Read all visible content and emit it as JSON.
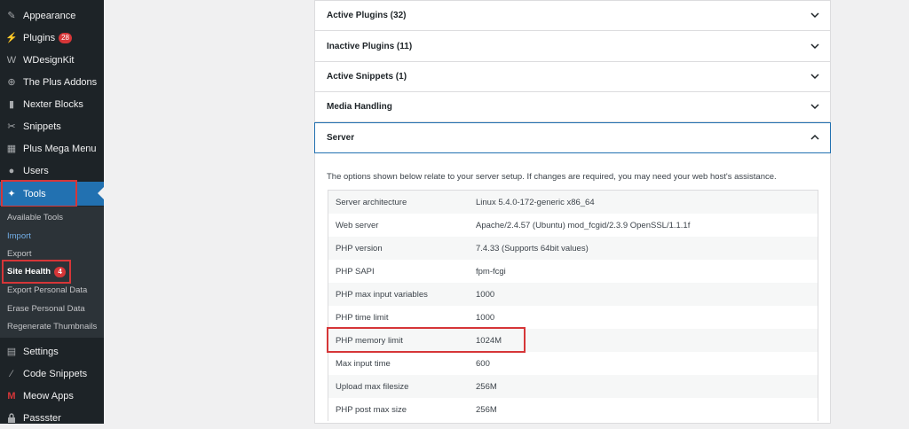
{
  "sidebar": {
    "items": [
      {
        "label": "Appearance",
        "icon": "paintbrush-icon",
        "glyph": "✎"
      },
      {
        "label": "Plugins",
        "icon": "plugin-icon",
        "glyph": "⚡",
        "badge": "28"
      },
      {
        "label": "WDesignKit",
        "icon": "wdesignkit-icon",
        "glyph": "W"
      },
      {
        "label": "The Plus Addons",
        "icon": "plus-addons-icon",
        "glyph": "⊕"
      },
      {
        "label": "Nexter Blocks",
        "icon": "nexter-icon",
        "glyph": "▮"
      },
      {
        "label": "Snippets",
        "icon": "scissors-icon",
        "glyph": "✂"
      },
      {
        "label": "Plus Mega Menu",
        "icon": "mega-menu-icon",
        "glyph": "▦"
      },
      {
        "label": "Users",
        "icon": "users-icon",
        "glyph": "●"
      },
      {
        "label": "Tools",
        "icon": "wrench-icon",
        "glyph": "✦"
      }
    ],
    "submenu": [
      {
        "label": "Available Tools"
      },
      {
        "label": "Import"
      },
      {
        "label": "Export"
      },
      {
        "label": "Site Health",
        "badge": "4"
      },
      {
        "label": "Export Personal Data"
      },
      {
        "label": "Erase Personal Data"
      },
      {
        "label": "Regenerate Thumbnails"
      }
    ],
    "bottom_items": [
      {
        "label": "Settings",
        "icon": "settings-icon",
        "glyph": "▤"
      },
      {
        "label": "Code Snippets",
        "icon": "code-snippets-icon",
        "glyph": "⁄"
      },
      {
        "label": "Meow Apps",
        "icon": "meow-icon",
        "glyph": "M"
      },
      {
        "label": "Passster",
        "icon": "lock-icon",
        "glyph": "🔒"
      }
    ]
  },
  "accordion": [
    {
      "label": "Active Plugins (32)"
    },
    {
      "label": "Inactive Plugins (11)"
    },
    {
      "label": "Active Snippets (1)"
    },
    {
      "label": "Media Handling"
    },
    {
      "label": "Server"
    }
  ],
  "server": {
    "intro": "The options shown below relate to your server setup. If changes are required, you may need your web host's assistance.",
    "rows": [
      {
        "key": "Server architecture",
        "value": "Linux 5.4.0-172-generic x86_64"
      },
      {
        "key": "Web server",
        "value": "Apache/2.4.57 (Ubuntu) mod_fcgid/2.3.9 OpenSSL/1.1.1f"
      },
      {
        "key": "PHP version",
        "value": "7.4.33 (Supports 64bit values)"
      },
      {
        "key": "PHP SAPI",
        "value": "fpm-fcgi"
      },
      {
        "key": "PHP max input variables",
        "value": "1000"
      },
      {
        "key": "PHP time limit",
        "value": "1000"
      },
      {
        "key": "PHP memory limit",
        "value": "1024M"
      },
      {
        "key": "Max input time",
        "value": "600"
      },
      {
        "key": "Upload max filesize",
        "value": "256M"
      },
      {
        "key": "PHP post max size",
        "value": "256M"
      }
    ]
  },
  "colors": {
    "sidebar_bg": "#1d2327",
    "active_blue": "#2271b1",
    "highlight_red": "#d63638"
  }
}
